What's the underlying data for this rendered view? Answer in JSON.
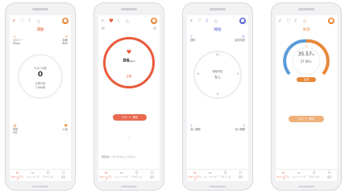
{
  "tabs": [
    {
      "label": "ウォームアップ",
      "icon": "home-icon"
    },
    {
      "label": "トレーニング",
      "icon": "dumbbell-icon"
    },
    {
      "label": "アクティビ",
      "icon": "activity-icon"
    },
    {
      "label": "設定",
      "icon": "settings-icon"
    }
  ],
  "screen1": {
    "title": "運動",
    "stat_tl_label": "カロリー",
    "stat_tl_value": "0kcal",
    "stat_tr_label": "距離",
    "stat_tr_value": "0km",
    "ring_label": "今日の歩数",
    "steps": "0",
    "goal_label": "目標歩数",
    "goal_value": "7,000歩",
    "stat_bl_label": "時間",
    "stat_bl_value": "0分",
    "stat_br_label": "心拍",
    "stat_br_value": "--"
  },
  "screen2": {
    "bpm": "86",
    "bpm_unit": "bpm",
    "status": "正常",
    "button": "スタート 測定",
    "footer": "測定前にリラックスしてください"
  },
  "screen3": {
    "title": "睡眠",
    "stat_tl": "就寝",
    "stat_tr": "起床時間",
    "center_label": "睡眠時間",
    "center_value": "なし",
    "stat_bl": "深い睡眠",
    "stat_br": "浅い睡眠",
    "clock": [
      "12",
      "3",
      "6",
      "9"
    ]
  },
  "screen4": {
    "title": "体温",
    "temp": "35.57",
    "temp_unit": "℃",
    "temp2": "37.80",
    "temp2_unit": "℃",
    "status": "正常",
    "button": "スタート 測定"
  },
  "colors": {
    "accent": "#e85a3a",
    "orange": "#e8883a",
    "blue": "#5d6ad4",
    "gauge_blue": "#5b9bd8"
  }
}
